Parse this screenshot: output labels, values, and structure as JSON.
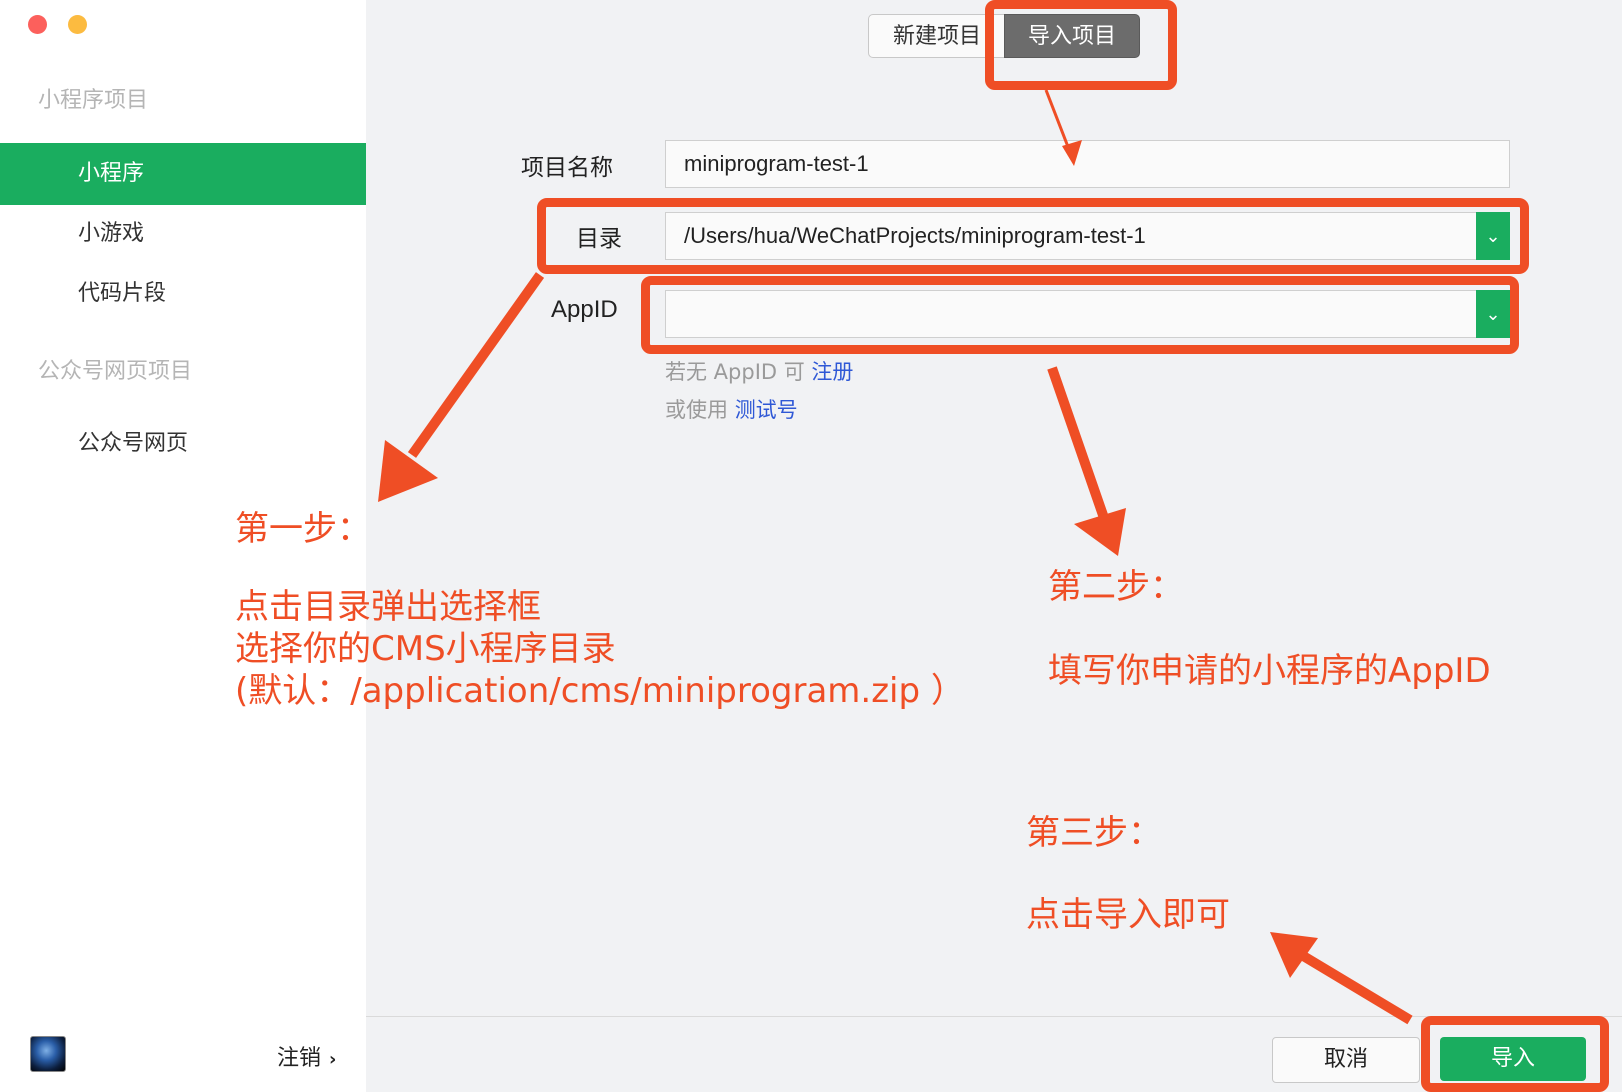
{
  "sidebar": {
    "section1_title": "小程序项目",
    "items1": [
      {
        "label": "小程序",
        "active": true
      },
      {
        "label": "小游戏",
        "active": false
      },
      {
        "label": "代码片段",
        "active": false
      }
    ],
    "section2_title": "公众号网页项目",
    "items2": [
      {
        "label": "公众号网页"
      }
    ],
    "logout_label": "注销",
    "logout_icon": "chevron-right-icon"
  },
  "tabs": {
    "new_project": "新建项目",
    "import_project": "导入项目"
  },
  "form": {
    "name_label": "项目名称",
    "name_value": "miniprogram-test-1",
    "dir_label": "目录",
    "dir_value": "/Users/hua/WeChatProjects/miniprogram-test-1",
    "appid_label": "AppID",
    "appid_value": "",
    "hint1_prefix": "若无 AppID 可 ",
    "hint1_link": "注册",
    "hint2_prefix": "或使用 ",
    "hint2_link": "测试号"
  },
  "footer": {
    "cancel_label": "取消",
    "import_label": "导入"
  },
  "annotations": {
    "step1_title": "第一步：",
    "step1_line1": "点击目录弹出选择框",
    "step1_line2": "选择你的CMS小程序目录",
    "step1_line3": "(默认：/application/cms/miniprogram.zip ）",
    "step2_title": "第二步：",
    "step2_line1": "填写你申请的小程序的AppID",
    "step3_title": "第三步：",
    "step3_line1": "点击导入即可"
  },
  "colors": {
    "accent_green": "#1aad5f",
    "annotation_orange": "#ef4e25",
    "link_blue": "#2f58d6"
  }
}
